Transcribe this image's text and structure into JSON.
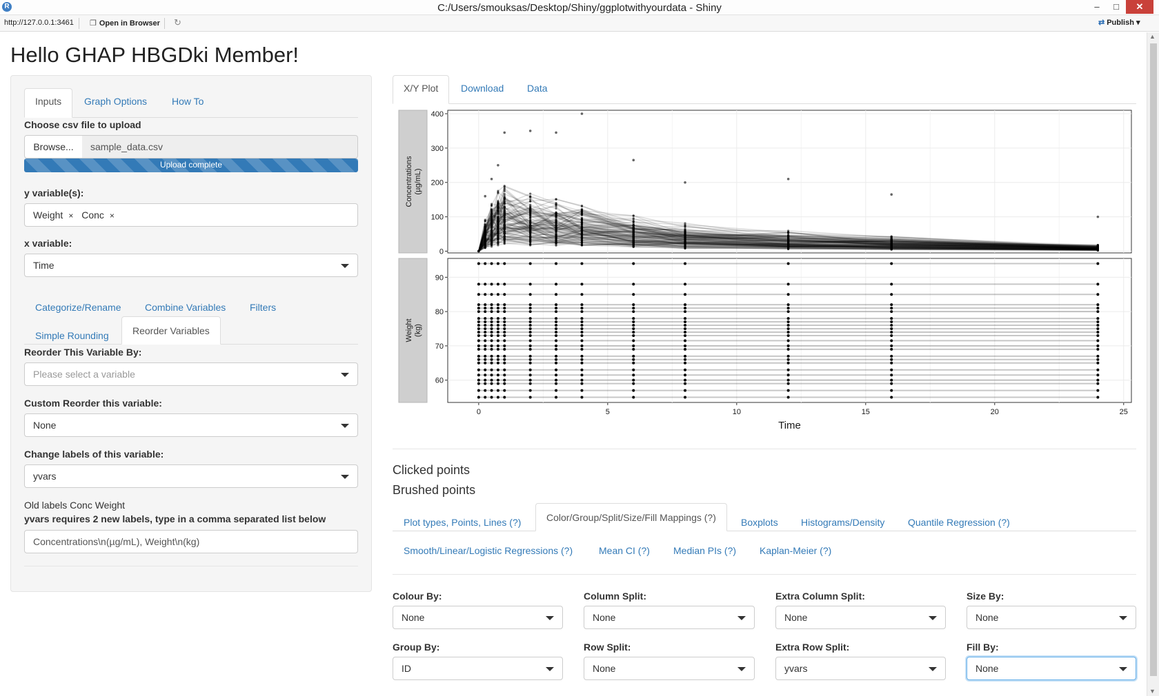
{
  "window": {
    "title": "C:/Users/smouksas/Desktop/Shiny/ggplotwithyourdata - Shiny",
    "minimize": "–",
    "maximize": "□",
    "close": "✕"
  },
  "toolbar": {
    "url": "http://127.0.0.1:3461",
    "open_in_browser": "Open in Browser",
    "publish": "Publish",
    "icons": [
      "open-browser-icon",
      "refresh-icon",
      "publish-icon"
    ]
  },
  "page": {
    "title": "Hello GHAP HBGDki Member!"
  },
  "sidebar": {
    "tabs": [
      {
        "label": "Inputs",
        "active": true
      },
      {
        "label": "Graph Options",
        "active": false
      },
      {
        "label": "How To",
        "active": false
      }
    ],
    "file_upload": {
      "label": "Choose csv file to upload",
      "browse_label": "Browse...",
      "file_name": "sample_data.csv",
      "status": "Upload complete",
      "progress": 1.0
    },
    "y_variables": {
      "label": "y variable(s):",
      "chips": [
        "Weight",
        "Conc"
      ],
      "remove_symbol": "×"
    },
    "x_variable": {
      "label": "x variable:",
      "value": "Time"
    },
    "subtabs_row1": [
      "Categorize/Rename",
      "Combine Variables",
      "Filters"
    ],
    "subtabs_row2": [
      {
        "label": "Simple Rounding",
        "active": false
      },
      {
        "label": "Reorder Variables",
        "active": true
      }
    ],
    "reorder_by": {
      "label": "Reorder This Variable By:",
      "placeholder": "Please select a variable"
    },
    "custom_reorder": {
      "label": "Custom Reorder this variable:",
      "value": "None"
    },
    "change_labels": {
      "label": "Change labels of this variable:",
      "value": "yvars"
    },
    "old_labels_text": "Old labels Conc Weight",
    "new_labels_instruction": "yvars requires 2 new labels, type in a comma separated list below",
    "new_labels_value": "Concentrations\\n(µg/mL), Weight\\n(kg)"
  },
  "main": {
    "tabs": [
      {
        "label": "X/Y Plot",
        "active": true
      },
      {
        "label": "Download",
        "active": false
      },
      {
        "label": "Data",
        "active": false
      }
    ],
    "clicked_points_heading": "Clicked points",
    "brushed_points_heading": "Brushed points",
    "option_tabs_row1": [
      {
        "label": "Plot types, Points, Lines (?)",
        "active": false
      },
      {
        "label": "Color/Group/Split/Size/Fill Mappings (?)",
        "active": true
      },
      {
        "label": "Boxplots",
        "active": false
      },
      {
        "label": "Histograms/Density",
        "active": false
      },
      {
        "label": "Quantile Regression (?)",
        "active": false
      }
    ],
    "option_tabs_row2": [
      {
        "label": "Smooth/Linear/Logistic Regressions (?)"
      },
      {
        "label": "Mean CI (?)"
      },
      {
        "label": "Median PIs (?)"
      },
      {
        "label": "Kaplan-Meier (?)"
      }
    ],
    "mappings": [
      {
        "label": "Colour By:",
        "value": "None"
      },
      {
        "label": "Column Split:",
        "value": "None"
      },
      {
        "label": "Extra Column Split:",
        "value": "None"
      },
      {
        "label": "Size By:",
        "value": "None"
      },
      {
        "label": "Group By:",
        "value": "ID"
      },
      {
        "label": "Row Split:",
        "value": "None"
      },
      {
        "label": "Extra Row Split:",
        "value": "yvars"
      },
      {
        "label": "Fill By:",
        "value": "None"
      }
    ]
  },
  "chart_data": {
    "type": "line",
    "xlabel": "Time",
    "x_ticks": [
      0,
      5,
      10,
      15,
      20,
      25
    ],
    "xlim": [
      -1.2,
      25.3
    ],
    "times": [
      0,
      0.25,
      0.5,
      0.75,
      1,
      2,
      3,
      4,
      6,
      8,
      12,
      16,
      24
    ],
    "grid": true,
    "panels": [
      {
        "strip_label": [
          "Concentrations",
          "(µg/mL)"
        ],
        "ylim": [
          -5,
          410
        ],
        "y_ticks": [
          0,
          100,
          200,
          300,
          400
        ],
        "max_values": [
          0,
          160,
          210,
          250,
          345,
          350,
          345,
          400,
          265,
          200,
          210,
          165,
          100
        ],
        "typical_values": [
          0,
          40,
          60,
          75,
          85,
          70,
          65,
          60,
          45,
          35,
          25,
          18,
          8
        ]
      },
      {
        "strip_label": [
          "Weight",
          "(kg)"
        ],
        "ylim": [
          53.5,
          95.5
        ],
        "y_ticks": [
          60,
          70,
          80,
          90
        ],
        "weights": [
          55,
          57,
          59,
          60,
          61.5,
          63,
          65,
          66,
          67,
          69,
          70,
          71.5,
          73,
          74,
          75,
          76,
          77,
          78,
          80,
          81,
          82,
          85,
          88,
          94
        ]
      }
    ]
  }
}
